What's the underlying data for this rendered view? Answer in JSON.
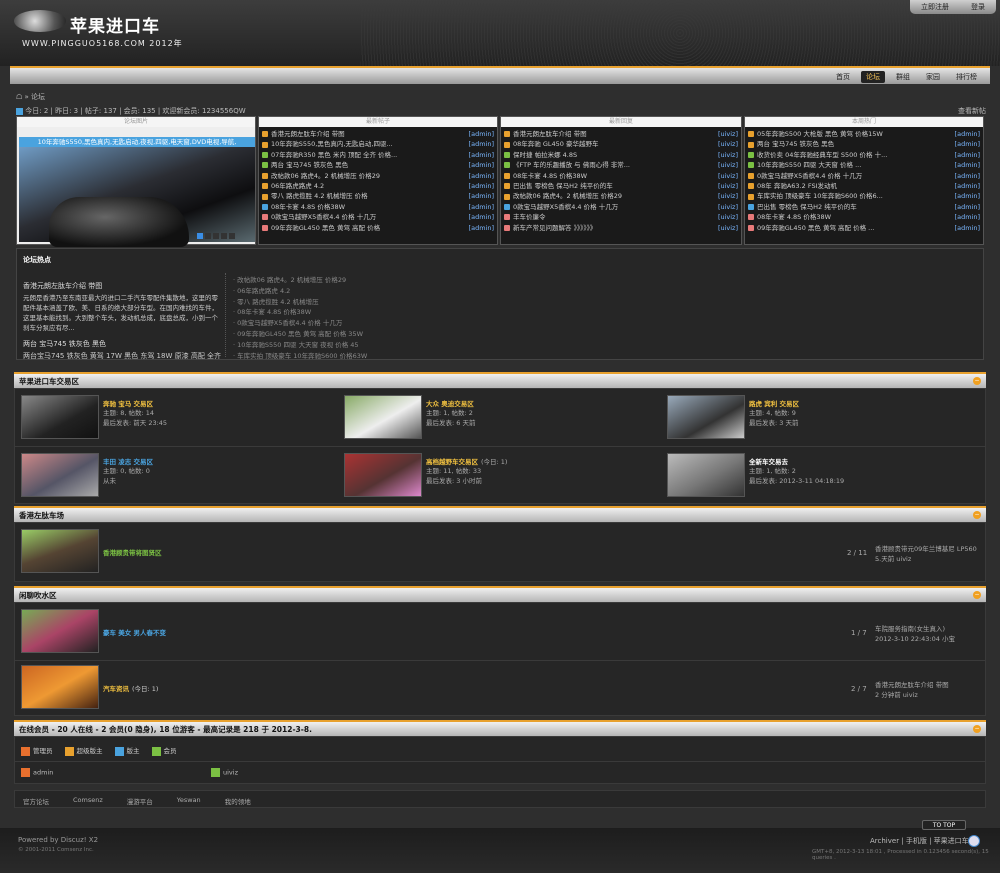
{
  "header": {
    "site_title": "苹果进口车",
    "site_sub": "WWW.PINGGUO5168.COM  2012年",
    "register": "立即注册",
    "login": "登录"
  },
  "nav": [
    "首页",
    "论坛",
    "群组",
    "家园",
    "排行榜"
  ],
  "breadcrumb": "» 论坛",
  "stats": "今日: 2 | 昨日: 3 | 帖子: 137 | 会员: 135 | 欢迎新会员: 1234556QW",
  "view_new": "查看新帖",
  "panel_headers": [
    "论坛图片",
    "最新帖子",
    "最新回复",
    "本周热门"
  ],
  "slide_caption": "10年奔驰S550,黑色真内,无匙启动,夜视,四驱,电天窗,DVD电视,导航,",
  "latest_posts": [
    {
      "t": "香港元朗左肽车介绍 带图",
      "u": "[admin]",
      "c": "#e8a12e"
    },
    {
      "t": "10年奔驰S550,黑色真内,无匙启动,四驱...",
      "u": "[admin]",
      "c": "#e8a12e"
    },
    {
      "t": "07年奔驰R350 黑色 米内 顶配 全齐 价格...",
      "u": "[admin]",
      "c": "#7bc043"
    },
    {
      "t": "两台 宝马745 铁灰色 黑色",
      "u": "[admin]",
      "c": "#7bc043"
    },
    {
      "t": "改帖款06 路虎4。2 机械增压 价格29",
      "u": "[admin]",
      "c": "#e8a12e"
    },
    {
      "t": "06年路虎路虎 4.2",
      "u": "[admin]",
      "c": "#e8a12e"
    },
    {
      "t": "零八 路虎揽胜 4.2 机械增压 价格",
      "u": "[admin]",
      "c": "#e8a12e"
    },
    {
      "t": "08年卡宴 4.8S 价格38W",
      "u": "[admin]",
      "c": "#4aa3df"
    },
    {
      "t": "0款宝马越野X5香槟4.4 价格 十几万",
      "u": "[admin]",
      "c": "#e87a7a"
    },
    {
      "t": "09年奔驰GL450 黑色 黄驾 高配 价格",
      "u": "[admin]",
      "c": "#e87a7a"
    }
  ],
  "latest_replies": [
    {
      "t": "香港元朗左肽车介绍 带图",
      "u": "[uiviz]",
      "c": "#e8a12e"
    },
    {
      "t": "08年奔驰 GL450 豪华越野车",
      "u": "[uiviz]",
      "c": "#e8a12e"
    },
    {
      "t": "保时捷 帕拉米娜 4.8S",
      "u": "[uiviz]",
      "c": "#7bc043"
    },
    {
      "t": "《FTP 车的乐趣播放 与 佛雨心得 非常...",
      "u": "[uiviz]",
      "c": "#7bc043"
    },
    {
      "t": "08年卡宴 4.8S 价格38W",
      "u": "[uiviz]",
      "c": "#e8a12e"
    },
    {
      "t": "巴出售 零榜色 保马H2 纯平价的车",
      "u": "[uiviz]",
      "c": "#e8a12e"
    },
    {
      "t": "改帖款06 路虎4。2 机械增压 价格29",
      "u": "[uiviz]",
      "c": "#e8a12e"
    },
    {
      "t": "0款宝马越野X5香槟4.4 价格 十几万",
      "u": "[uiviz]",
      "c": "#4aa3df"
    },
    {
      "t": "丰车价廉令",
      "u": "[uiviz]",
      "c": "#e87a7a"
    },
    {
      "t": "新车产常见问题解答 》》》》》》",
      "u": "[uiviz]",
      "c": "#e87a7a"
    }
  ],
  "weekly_hot": [
    {
      "t": "05年奔驰S500 大枪版 黑色 黄驾 价格15W",
      "u": "[admin]",
      "c": "#e8a12e"
    },
    {
      "t": "两台 宝马745 铁灰色 黑色",
      "u": "[admin]",
      "c": "#e8a12e"
    },
    {
      "t": "收货价卖 04年奔驰经典车型 S500 价格 十...",
      "u": "[admin]",
      "c": "#7bc043"
    },
    {
      "t": "10年奔驰S550 四驱 大天窗 价格 ...",
      "u": "[admin]",
      "c": "#7bc043"
    },
    {
      "t": "0款宝马越野X5香槟4.4 价格 十几万",
      "u": "[admin]",
      "c": "#e8a12e"
    },
    {
      "t": "08年 奔驰A63.2 FSI发动机",
      "u": "[admin]",
      "c": "#e8a12e"
    },
    {
      "t": "车库实拍 顶级豪车 10年奔驰S600 价格6...",
      "u": "[admin]",
      "c": "#e8a12e"
    },
    {
      "t": "巴出售 零榜色 保马H2 纯平价的车",
      "u": "[admin]",
      "c": "#4aa3df"
    },
    {
      "t": "08年卡宴 4.8S 价格38W",
      "u": "[admin]",
      "c": "#e87a7a"
    },
    {
      "t": "09年奔驰GL450 黑色 黄驾 高配 价格 ...",
      "u": "[admin]",
      "c": "#e87a7a"
    }
  ],
  "hot": {
    "title": "论坛热点",
    "lead_title": "香港元朗左肽车介绍 带图",
    "lead_text": "元朗是香港乃至东南亚最大的进口二手汽车零配件集散地，这里的零配件基本涵盖了欧、美、日系的绝大部分车型。在国内难找的车件，这里基本能找到。大到整个车头，发动机总成，底盘总成，小到一个刹车分泵应有尽...",
    "second_title": "两台 宝马745 铁灰色 黑色",
    "second_text": "两台宝马745 铁灰色 黄驾 17W 黑色 东驾 18W 原漆 高配 全齐",
    "list": [
      "· 改帖款06 路虎4。2 机械增压 价格29",
      "· 06年路虎路虎 4.2",
      "· 零八 路虎揽胜 4.2 机械增压",
      "· 08年卡宴 4.8S 价格38W",
      "· 0款宝马越野X5香槟4.4 价格 十几万",
      "· 09年奔驰GL450 黑色 黄驾 高配 价格 35W",
      "· 10年奔驰S550 四驱 大天窗 夜视 价格 45",
      "· 车库实拍 顶级豪车 10年奔驰S600 价格63W"
    ]
  },
  "sections": [
    {
      "title": "苹果进口车交易区"
    },
    {
      "title": "香港左肽车场"
    },
    {
      "title": "闲聊吹水区"
    },
    {
      "title": "在线会员 - 20 人在线 - 2 会员(0 隐身), 18 位游客 - 最高记录是 218 于 2012-3-8."
    }
  ],
  "trade_forums": [
    {
      "name": "奔驰 宝马 交易区",
      "color": "#f0c040",
      "l1": "主题: 8, 帖数: 14",
      "l2": "最后发表: 前天 23:45"
    },
    {
      "name": "大众 奥迪交易区",
      "color": "#f0c040",
      "l1": "主题: 1, 帖数: 2",
      "l2": "最后发表: 6 天前"
    },
    {
      "name": "路虎 宾利 交易区",
      "color": "#f0c040",
      "l1": "主题: 4, 帖数: 9",
      "l2": "最后发表: 3 天前"
    },
    {
      "name": "丰田 凌志 交易区",
      "color": "#4aa3df",
      "l1": "主题: 0, 帖数: 0",
      "l2": "从未"
    },
    {
      "name": "高档越野车交易区",
      "color": "#f0c040",
      "extra": "(今日: 1)",
      "l1": "主题: 11, 帖数: 33",
      "l2": "最后发表: 3 小时前"
    },
    {
      "name": "全新车交易去",
      "color": "#ffffff",
      "l1": "主题: 1, 帖数: 2",
      "l2": "最后发表: 2012-3-11 04:18:19"
    }
  ],
  "hk_forum": {
    "name": "香港顾贵带将图贤区",
    "color": "#7bc043",
    "count": "2 / 11",
    "last1": "香港顾贵带元09年兰博基尼 LP560 ...",
    "last2": "5 天前 uiviz"
  },
  "chat_forums": [
    {
      "name": "豪车 美女 男人春不变",
      "color": "#4aa3df",
      "extra": "",
      "count": "1 / 7",
      "last1": "车院服务指南(女生真入)",
      "last2": "2012-3-10 22:43:04 小宝"
    },
    {
      "name": "汽车资讯",
      "color": "#f0c040",
      "extra": "(今日: 1)",
      "count": "2 / 7",
      "last1": "香港元朗左肽车介绍 带图",
      "last2": "2 分钟前 uiviz"
    }
  ],
  "online": {
    "legend": [
      {
        "label": "管理员",
        "c": "#e8702e"
      },
      {
        "label": "超级版主",
        "c": "#e8a12e"
      },
      {
        "label": "版主",
        "c": "#4aa3df"
      },
      {
        "label": "会员",
        "c": "#7bc043"
      }
    ],
    "users": [
      {
        "name": "admin",
        "c": "#e8702e"
      },
      {
        "name": "uiviz",
        "c": "#7bc043"
      }
    ]
  },
  "links": [
    "官方论坛",
    "Comsenz",
    "漫游平台",
    "Yeswan",
    "我的领地"
  ],
  "footer": {
    "powered": "Powered by Discuz! X2",
    "copy": "© 2001-2011 Comsenz Inc.",
    "right_links": "Archiver | 手机版 | 苹果进口车",
    "gmt": "GMT+8, 2012-3-13 18:01 , Processed in 0.123456 second(s), 15 queries .",
    "totop": "TO TOP"
  }
}
